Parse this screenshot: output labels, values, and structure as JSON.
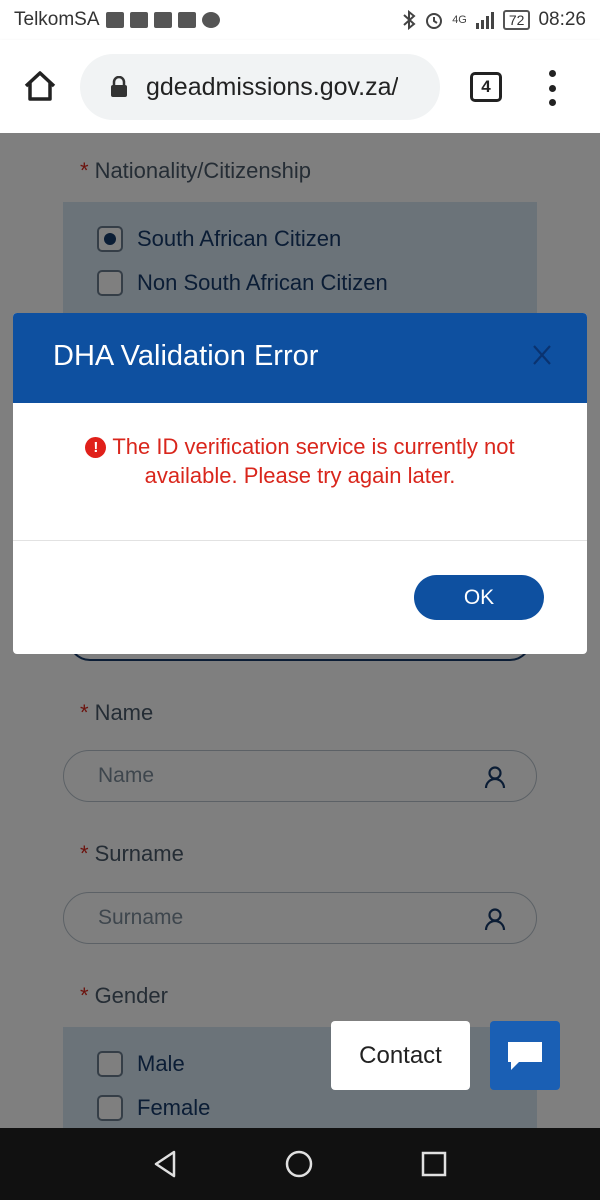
{
  "status_bar": {
    "carrier": "TelkomSA",
    "network": "4G",
    "battery": "72",
    "time": "08:26"
  },
  "browser": {
    "url": "gdeadmissions.gov.za/",
    "tab_count": "4"
  },
  "form": {
    "nationality": {
      "label": "Nationality/Citizenship",
      "options": [
        "South African Citizen",
        "Non South African Citizen"
      ],
      "selected": "South African Citizen"
    },
    "name": {
      "label": "Name",
      "placeholder": "Name"
    },
    "surname": {
      "label": "Surname",
      "placeholder": "Surname"
    },
    "gender": {
      "label": "Gender",
      "options": [
        "Male",
        "Female"
      ]
    },
    "required_marker": "*"
  },
  "modal": {
    "title": "DHA Validation Error",
    "close": "X",
    "error_icon": "!",
    "message": "The ID verification service is currently not available. Please try again later.",
    "ok_label": "OK"
  },
  "contact": {
    "label": "Contact"
  },
  "colors": {
    "primary": "#0e50a0",
    "error": "#d9261c",
    "option_background": "#d6e6f3"
  }
}
